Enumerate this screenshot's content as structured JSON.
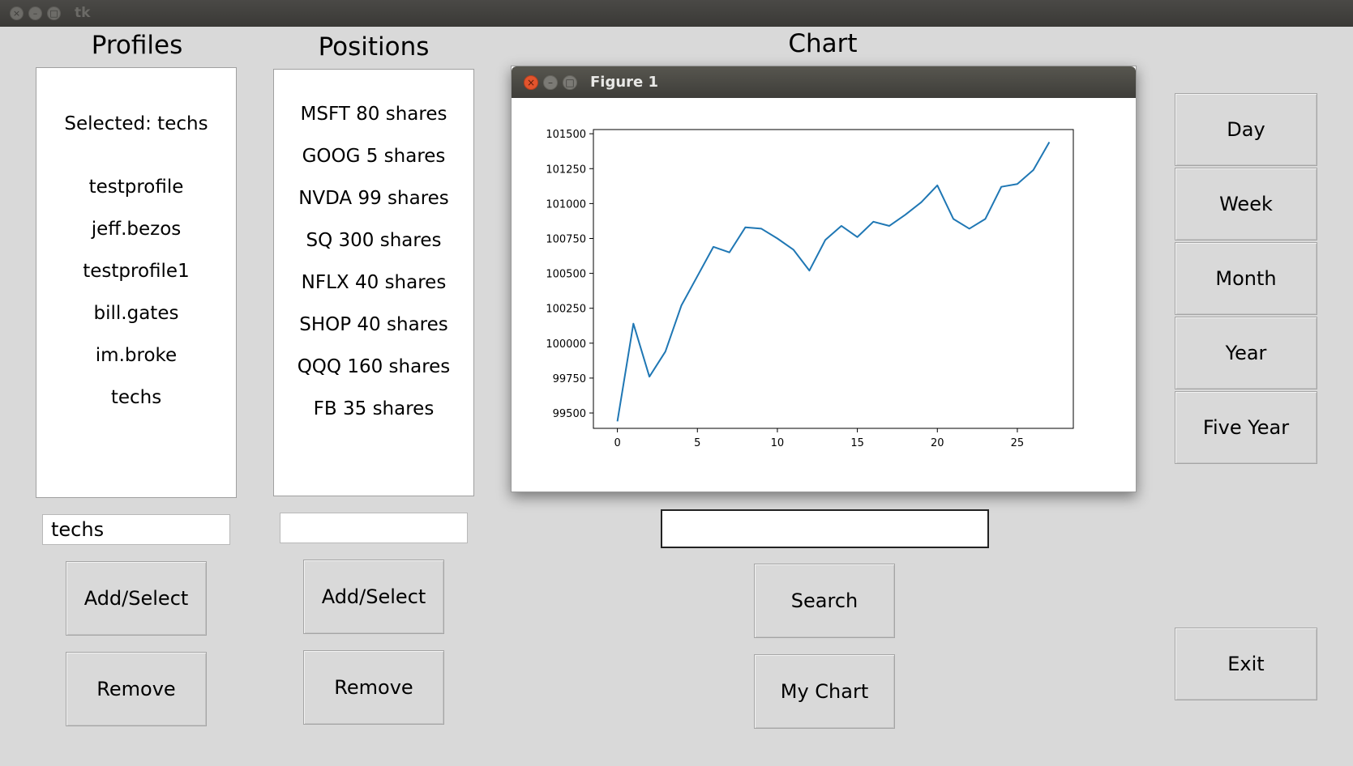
{
  "window": {
    "title": "tk",
    "close_glyph": "×",
    "min_glyph": "–",
    "max_glyph": "□"
  },
  "profiles": {
    "heading": "Profiles",
    "selected_text": "Selected: techs",
    "items": [
      "testprofile",
      "jeff.bezos",
      "testprofile1",
      "bill.gates",
      "im.broke",
      "techs"
    ],
    "entry_value": "techs",
    "add_label": "Add/Select",
    "remove_label": "Remove"
  },
  "positions": {
    "heading": "Positions",
    "items": [
      "MSFT 80 shares",
      "GOOG 5 shares",
      "NVDA 99 shares",
      "SQ 300 shares",
      "NFLX 40 shares",
      "SHOP 40 shares",
      "QQQ 160 shares",
      "FB 35 shares"
    ],
    "entry_value": "",
    "add_label": "Add/Select",
    "remove_label": "Remove"
  },
  "chart_section": {
    "heading": "Chart",
    "search_value": "",
    "search_label": "Search",
    "my_chart_label": "My Chart"
  },
  "figure": {
    "title": "Figure 1",
    "close_glyph": "×",
    "min_glyph": "–",
    "max_glyph": "□",
    "close_color": "#e2542d"
  },
  "timeframes": [
    "Day",
    "Week",
    "Month",
    "Year",
    "Five Year"
  ],
  "exit_label": "Exit",
  "chart_data": {
    "type": "line",
    "title": "",
    "xlabel": "",
    "ylabel": "",
    "xlim": [
      -1.5,
      28.5
    ],
    "ylim": [
      99390,
      101530
    ],
    "xticks": [
      0,
      5,
      10,
      15,
      20,
      25
    ],
    "yticks": [
      99500,
      99750,
      100000,
      100250,
      100500,
      100750,
      101000,
      101250,
      101500
    ],
    "grid": false,
    "line_color": "#1f77b4",
    "series": [
      {
        "x": [
          0,
          1,
          2,
          3,
          4,
          5,
          6,
          7,
          8,
          9,
          10,
          11,
          12,
          13,
          14,
          15,
          16,
          17,
          18,
          19,
          20,
          21,
          22,
          23,
          24,
          25,
          26,
          27
        ],
        "values": [
          99440,
          100140,
          99760,
          99940,
          100270,
          100480,
          100690,
          100650,
          100830,
          100820,
          100750,
          100670,
          100520,
          100740,
          100840,
          100760,
          100870,
          100840,
          100920,
          101010,
          101130,
          100890,
          100820,
          100890,
          101120,
          101140,
          101240,
          101440
        ]
      }
    ]
  }
}
